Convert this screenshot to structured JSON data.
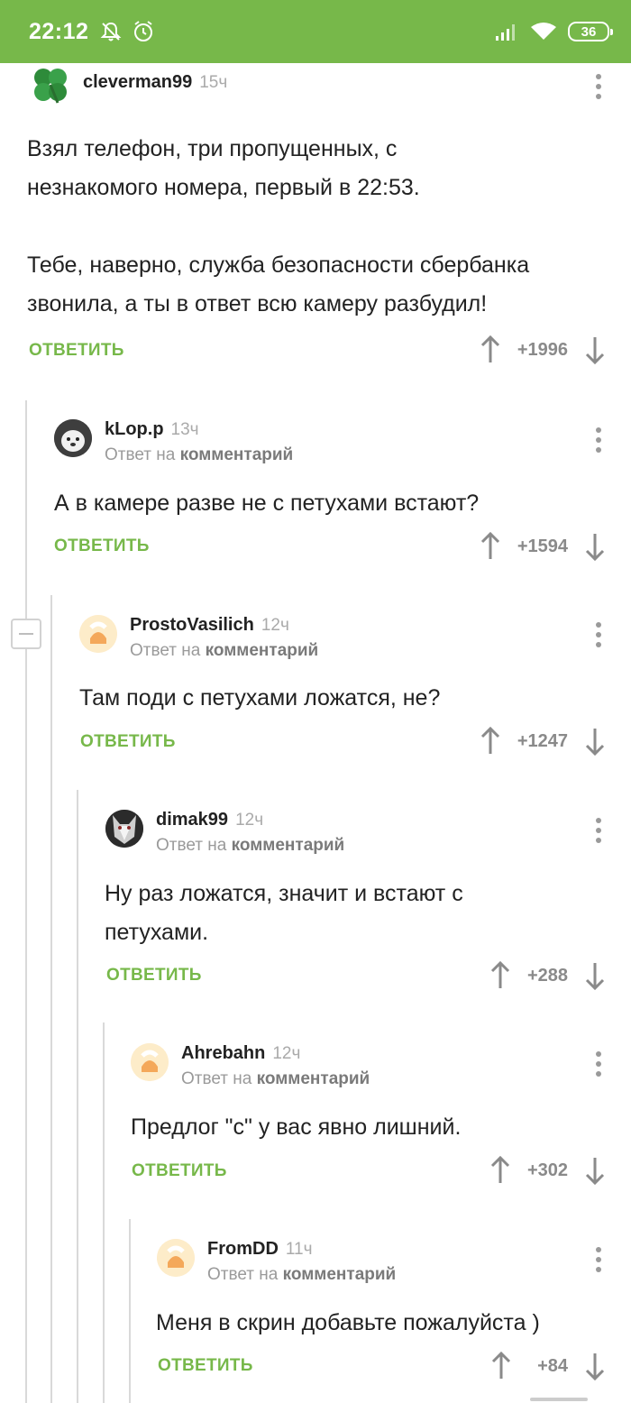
{
  "status_bar": {
    "time": "22:12",
    "battery": "36",
    "icons": [
      "mute-bell-icon",
      "alarm-icon",
      "signal-icon",
      "wifi-icon",
      "battery-icon"
    ]
  },
  "colors": {
    "accent": "#77b84a",
    "muted": "#9a9a9a",
    "score": "#8a8a8a"
  },
  "reply_to_prefix": "Ответ на",
  "reply_to_link": "комментарий",
  "reply_label": "ОТВЕТИТЬ",
  "comments": [
    {
      "user": "cleverman99",
      "time": "15ч",
      "reply": false,
      "lines": [
        "Взял телефон, три пропущенных, с",
        "незнакомого номера, первый в 22:53.",
        "",
        "Тебе, наверно, служба безопасности сбербанка",
        "звонила, а ты в ответ всю камеру разбудил!"
      ],
      "score": "+1996",
      "avatar": "clover-icon"
    },
    {
      "user": "kLop.p",
      "time": "13ч",
      "reply": true,
      "lines": [
        "А в камере разве не с петухами встают?"
      ],
      "score": "+1594",
      "avatar": "dog-avatar"
    },
    {
      "user": "ProstoVasilich",
      "time": "12ч",
      "reply": true,
      "lines": [
        "Там поди с петухами ложатся, не?"
      ],
      "score": "+1247",
      "avatar": "default-avatar"
    },
    {
      "user": "dimak99",
      "time": "12ч",
      "reply": true,
      "lines": [
        "Ну раз ложатся, значит и встают с",
        "петухами."
      ],
      "score": "+288",
      "avatar": "husky-avatar"
    },
    {
      "user": "Ahrebahn",
      "time": "12ч",
      "reply": true,
      "lines": [
        "Предлог \"с\" у вас явно лишний."
      ],
      "score": "+302",
      "avatar": "default-avatar"
    },
    {
      "user": "FromDD",
      "time": "11ч",
      "reply": true,
      "lines": [
        "Меня в скрин добавьте пожалуйста )"
      ],
      "score": "+84",
      "avatar": "default-avatar"
    }
  ]
}
